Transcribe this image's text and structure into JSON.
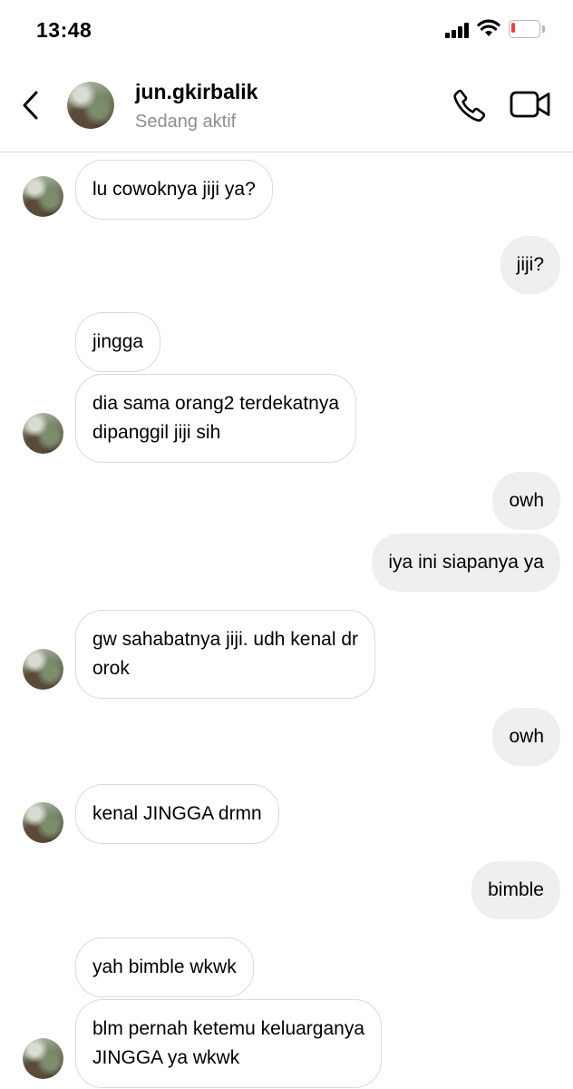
{
  "status_bar": {
    "time": "13:48",
    "icons": [
      "cellular-signal-icon",
      "wifi-icon",
      "battery-low-icon"
    ],
    "battery_level": 0.15,
    "battery_color": "#ff3b30"
  },
  "header": {
    "back_icon": "chevron-left-icon",
    "username": "jun.gkirbalik",
    "status": "Sedang aktif",
    "call_icon": "phone-icon",
    "video_icon": "video-camera-icon"
  },
  "messages": [
    {
      "side": "in",
      "text": "lu cowoknya jiji ya?"
    },
    {
      "side": "out",
      "text": "jiji?"
    },
    {
      "side": "in",
      "text": "jingga"
    },
    {
      "side": "in",
      "lines": [
        "dia sama orang2 terdekatnya",
        "dipanggil jiji sih"
      ]
    },
    {
      "side": "out",
      "text": "owh"
    },
    {
      "side": "out",
      "text": "iya ini siapanya ya"
    },
    {
      "side": "in",
      "lines": [
        "gw sahabatnya jiji. udh kenal dr",
        "orok"
      ]
    },
    {
      "side": "out",
      "text": "owh"
    },
    {
      "side": "in",
      "text": "kenal JINGGA drmn"
    },
    {
      "side": "out",
      "text": "bimble"
    },
    {
      "side": "in",
      "text": "yah bimble wkwk"
    },
    {
      "side": "in",
      "lines": [
        "blm pernah ketemu keluarganya",
        "JINGGA ya wkwk"
      ]
    }
  ],
  "colors": {
    "incoming_border": "#dbdbdb",
    "outgoing_bg": "#efefef",
    "secondary_text": "#8e8e8e"
  }
}
